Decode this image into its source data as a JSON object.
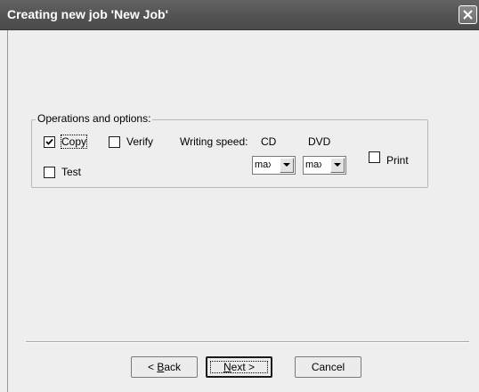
{
  "window": {
    "title": "Creating new job 'New Job'",
    "close_icon": "close-icon"
  },
  "options_group": {
    "legend": "Operations and options:",
    "copy": {
      "label": "Copy",
      "checked": true
    },
    "verify": {
      "label": "Verify",
      "checked": false
    },
    "test": {
      "label": "Test",
      "checked": false
    },
    "print": {
      "label": "Print",
      "checked": false
    },
    "writing_speed_label": "Writing speed:",
    "cd_label": "CD",
    "dvd_label": "DVD",
    "cd_speed": {
      "value": "max",
      "arrow_icon": "chevron-down-icon"
    },
    "dvd_speed": {
      "value": "max",
      "arrow_icon": "chevron-down-icon"
    }
  },
  "buttons": {
    "back": {
      "prefix": "< ",
      "mnemonic": "B",
      "rest": "ack"
    },
    "next": {
      "mnemonic": "N",
      "rest": "ext >"
    },
    "cancel": "Cancel"
  },
  "colors": {
    "titlebar": "#545454",
    "dialog_bg": "#eeeeee"
  }
}
